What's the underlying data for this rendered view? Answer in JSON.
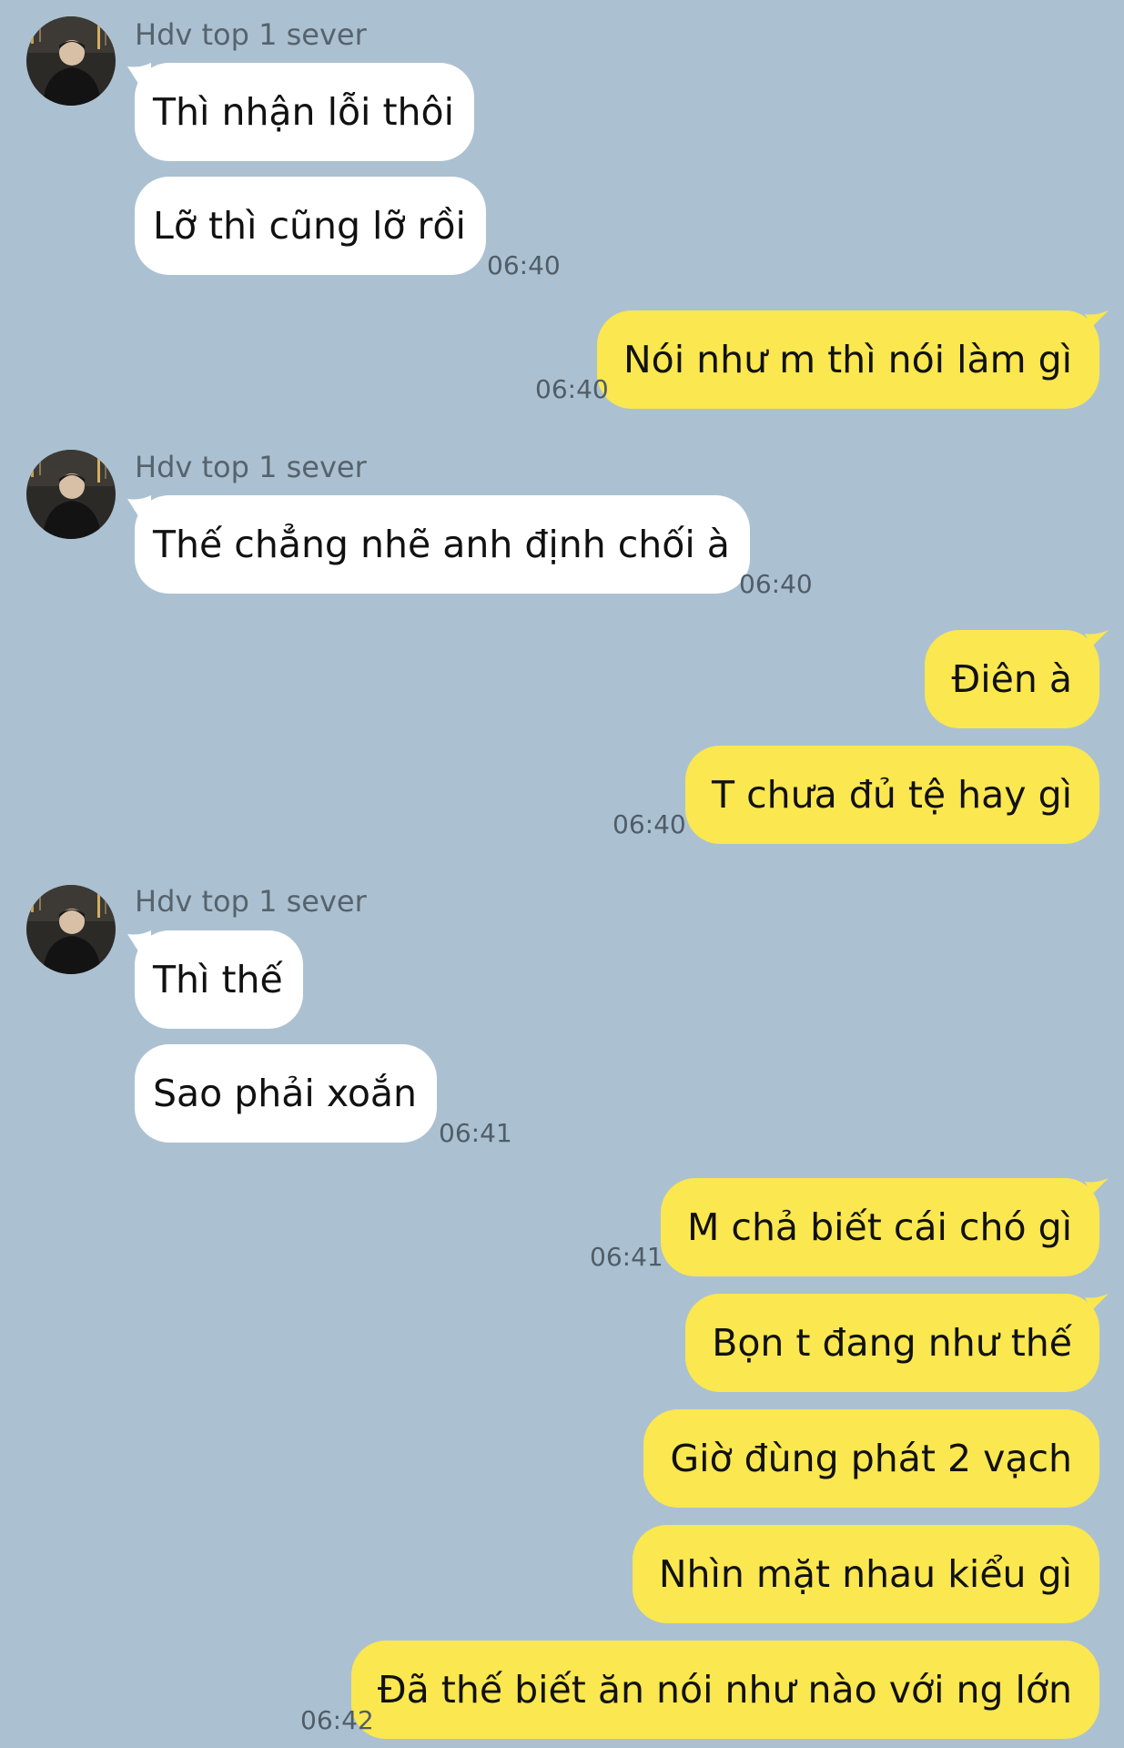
{
  "colors": {
    "background": "#abc1d1",
    "incoming_bubble": "#ffffff",
    "outgoing_bubble": "#fbe74f",
    "timestamp": "#4f5d68",
    "sender_name": "#56636d"
  },
  "messages": [
    {
      "direction": "in",
      "sender": "Hdv top 1 sever",
      "avatar": "profile-photo",
      "texts": [
        "Thì nhận lỗi thôi",
        "Lỡ thì cũng lỡ rồi"
      ],
      "time": "06:40"
    },
    {
      "direction": "out",
      "texts": [
        "Nói như m thì nói làm gì"
      ],
      "time": "06:40"
    },
    {
      "direction": "in",
      "sender": "Hdv top 1 sever",
      "avatar": "profile-photo",
      "texts": [
        "Thế chẳng nhẽ anh định chối à"
      ],
      "time": "06:40"
    },
    {
      "direction": "out",
      "texts": [
        "Điên à",
        "T chưa đủ tệ hay gì"
      ],
      "time": "06:40"
    },
    {
      "direction": "in",
      "sender": "Hdv top 1 sever",
      "avatar": "profile-photo",
      "texts": [
        "Thì thế",
        "Sao phải xoắn"
      ],
      "time": "06:41"
    },
    {
      "direction": "out",
      "texts": [
        "M chả biết cái chó gì"
      ],
      "time": "06:41"
    },
    {
      "direction": "out",
      "texts": [
        "Bọn t đang như thế",
        "Giờ đùng phát 2 vạch",
        "Nhìn mặt nhau kiểu gì",
        "Đã thế biết ăn nói như nào với ng lớn"
      ],
      "time": "06:42"
    }
  ]
}
